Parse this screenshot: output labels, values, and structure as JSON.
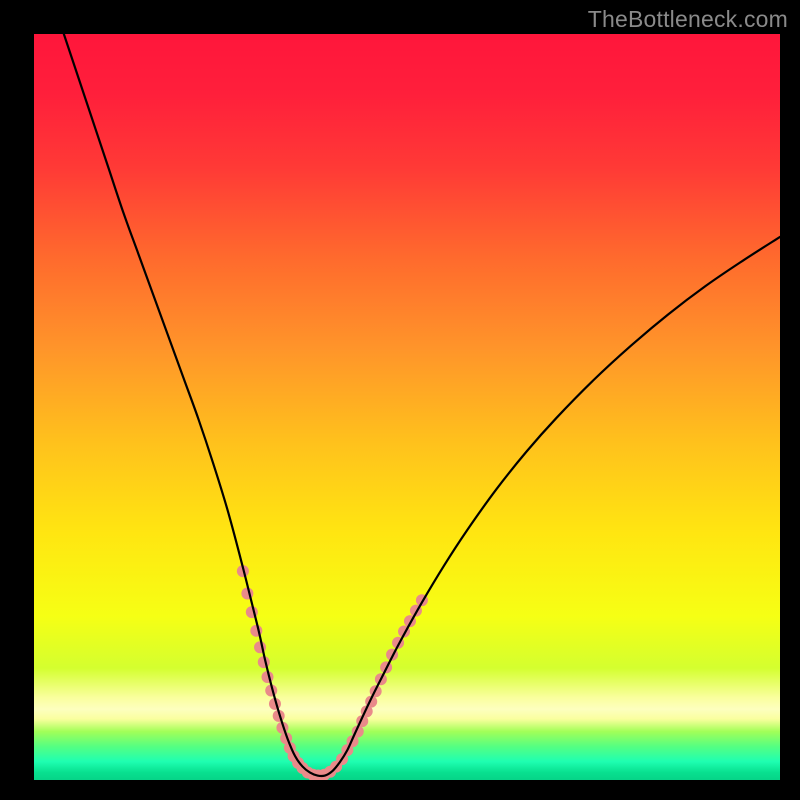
{
  "watermark": {
    "text": "TheBottleneck.com"
  },
  "gradient": {
    "stops": [
      {
        "offset": 0.0,
        "color": "#ff163b"
      },
      {
        "offset": 0.08,
        "color": "#ff1f3b"
      },
      {
        "offset": 0.18,
        "color": "#ff3a36"
      },
      {
        "offset": 0.3,
        "color": "#ff6a2d"
      },
      {
        "offset": 0.42,
        "color": "#ff942a"
      },
      {
        "offset": 0.55,
        "color": "#ffc21c"
      },
      {
        "offset": 0.67,
        "color": "#ffe611"
      },
      {
        "offset": 0.78,
        "color": "#f6ff14"
      },
      {
        "offset": 0.85,
        "color": "#d4ff2f"
      },
      {
        "offset": 0.89,
        "color": "#faff9f"
      },
      {
        "offset": 0.905,
        "color": "#fdffbf"
      },
      {
        "offset": 0.918,
        "color": "#faff9f"
      },
      {
        "offset": 0.935,
        "color": "#a2ff58"
      },
      {
        "offset": 0.955,
        "color": "#55ff82"
      },
      {
        "offset": 0.975,
        "color": "#1fffb1"
      },
      {
        "offset": 0.99,
        "color": "#08e08f"
      },
      {
        "offset": 1.0,
        "color": "#06d488"
      }
    ]
  },
  "chart_data": {
    "type": "line",
    "title": "",
    "xlabel": "",
    "ylabel": "",
    "xlim": [
      0,
      100
    ],
    "ylim": [
      0,
      100
    ],
    "grid": false,
    "series": [
      {
        "name": "bottleneck-curve",
        "x": [
          4,
          6,
          8,
          10,
          12,
          14,
          16,
          18,
          20,
          22,
          24,
          26,
          28,
          30,
          31,
          32,
          33,
          34,
          35,
          36,
          37,
          38,
          39,
          40,
          41,
          42,
          43,
          45,
          47,
          49,
          52,
          55,
          58,
          62,
          66,
          70,
          75,
          80,
          85,
          90,
          95,
          100
        ],
        "y": [
          100,
          94,
          88,
          82,
          76,
          70.5,
          65,
          59.5,
          54,
          48.5,
          42.5,
          36,
          28.5,
          20.5,
          16,
          12,
          8.5,
          5.5,
          3.2,
          1.8,
          1.0,
          0.6,
          0.6,
          1.2,
          2.4,
          4.0,
          6.2,
          10.5,
          14.5,
          18.4,
          23.8,
          28.8,
          33.4,
          39.0,
          44.0,
          48.5,
          53.6,
          58.2,
          62.4,
          66.2,
          69.6,
          72.8
        ]
      }
    ],
    "markers": {
      "name": "highlight-dots",
      "comment": "pink marker cluster near valley + flanks",
      "color": "#e98a8a",
      "radius_px": 6,
      "points": [
        {
          "x": 28.0,
          "y": 28.0
        },
        {
          "x": 28.6,
          "y": 25.0
        },
        {
          "x": 29.2,
          "y": 22.5
        },
        {
          "x": 29.8,
          "y": 20.0
        },
        {
          "x": 30.3,
          "y": 17.8
        },
        {
          "x": 30.8,
          "y": 15.8
        },
        {
          "x": 31.3,
          "y": 13.8
        },
        {
          "x": 31.8,
          "y": 12.0
        },
        {
          "x": 32.3,
          "y": 10.2
        },
        {
          "x": 32.8,
          "y": 8.6
        },
        {
          "x": 33.3,
          "y": 7.0
        },
        {
          "x": 33.8,
          "y": 5.6
        },
        {
          "x": 34.3,
          "y": 4.3
        },
        {
          "x": 34.8,
          "y": 3.2
        },
        {
          "x": 35.4,
          "y": 2.3
        },
        {
          "x": 36.0,
          "y": 1.6
        },
        {
          "x": 36.7,
          "y": 1.0
        },
        {
          "x": 37.4,
          "y": 0.7
        },
        {
          "x": 38.1,
          "y": 0.6
        },
        {
          "x": 38.9,
          "y": 0.7
        },
        {
          "x": 39.7,
          "y": 1.1
        },
        {
          "x": 40.5,
          "y": 1.8
        },
        {
          "x": 41.3,
          "y": 2.8
        },
        {
          "x": 42.0,
          "y": 4.0
        },
        {
          "x": 42.7,
          "y": 5.2
        },
        {
          "x": 43.4,
          "y": 6.5
        },
        {
          "x": 44.0,
          "y": 7.9
        },
        {
          "x": 44.6,
          "y": 9.2
        },
        {
          "x": 45.2,
          "y": 10.5
        },
        {
          "x": 45.8,
          "y": 11.9
        },
        {
          "x": 46.5,
          "y": 13.5
        },
        {
          "x": 47.2,
          "y": 15.1
        },
        {
          "x": 48.0,
          "y": 16.8
        },
        {
          "x": 48.8,
          "y": 18.4
        },
        {
          "x": 49.6,
          "y": 19.9
        },
        {
          "x": 50.4,
          "y": 21.3
        },
        {
          "x": 51.2,
          "y": 22.7
        },
        {
          "x": 52.0,
          "y": 24.1
        }
      ]
    }
  }
}
